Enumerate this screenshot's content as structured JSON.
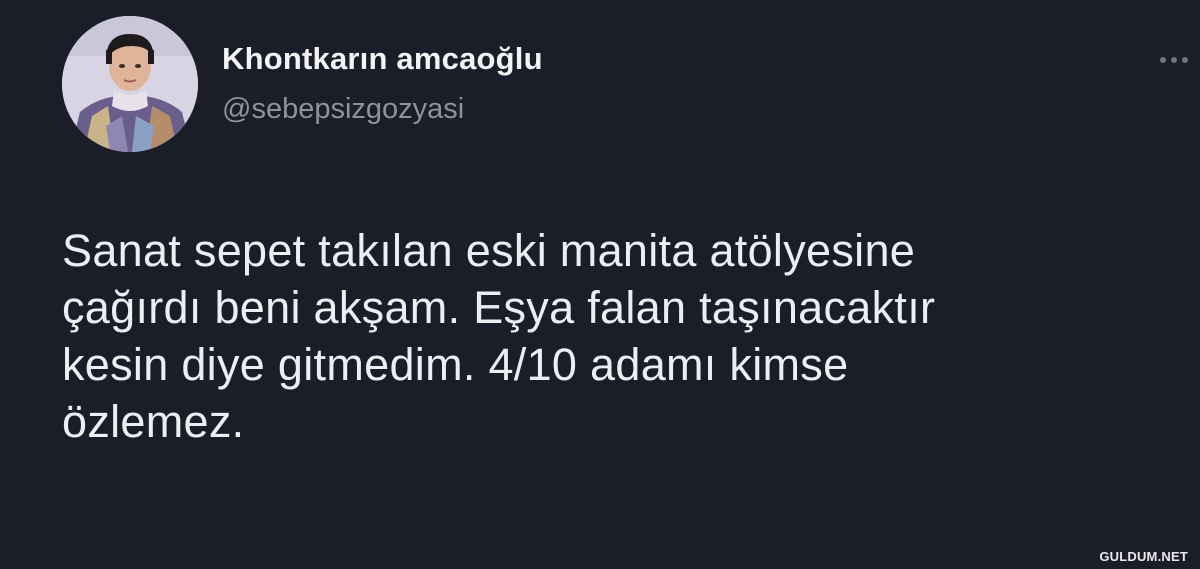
{
  "author": {
    "display_name": "Khontkarın amcaoğlu",
    "handle": "@sebepsizgozyasi",
    "avatar_icon": "profile-photo-icon"
  },
  "menu": {
    "more_icon": "more-options-icon"
  },
  "tweet": {
    "lines": [
      "Sanat sepet takılan eski manita atölyesine",
      "çağırdı beni akşam. Eşya falan taşınacaktır",
      "kesin diye gitmedim. 4/10 adamı kimse",
      "özlemez."
    ]
  },
  "watermark": "GULDUM.NET",
  "colors": {
    "background": "#1b1d29",
    "primary_text": "#eceef1",
    "secondary_text": "#8b939c"
  }
}
